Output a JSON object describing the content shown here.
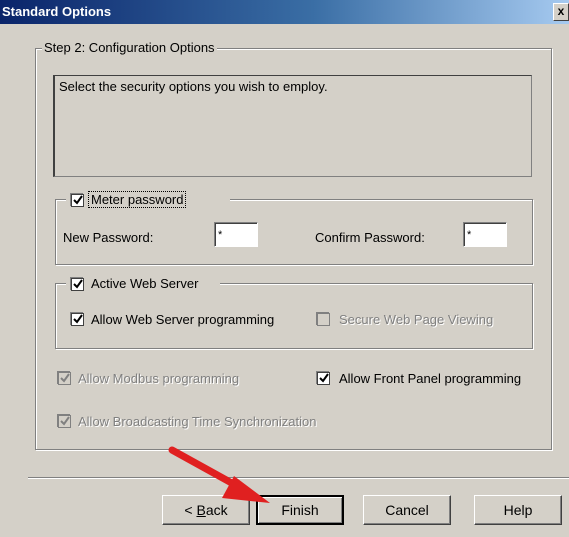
{
  "window": {
    "title": "Standard Options",
    "close_glyph": "x"
  },
  "step_group": {
    "legend": "Step 2: Configuration Options"
  },
  "description": "Select the security options you wish to employ.",
  "meter_password": {
    "label": "Meter password",
    "checked": true,
    "new_password_label": "New Password:",
    "new_password_value": "*",
    "confirm_password_label": "Confirm Password:",
    "confirm_password_value": "*"
  },
  "web_server": {
    "label": "Active Web Server",
    "checked": true,
    "allow_programming_label": "Allow Web Server programming",
    "secure_viewing_label": "Secure Web Page Viewing"
  },
  "options": {
    "modbus_label": "Allow Modbus programming",
    "front_panel_label": "Allow Front Panel programming",
    "broadcast_label": "Allow Broadcasting Time Synchronization"
  },
  "buttons": {
    "back_pre": "< ",
    "back_accel": "B",
    "back_rest": "ack",
    "finish": "Finish",
    "cancel": "Cancel",
    "help": "Help"
  },
  "colors": {
    "title_start": "#0a246a",
    "dialog_bg": "#d4d0c8",
    "annotation_arrow": "#e02020"
  }
}
